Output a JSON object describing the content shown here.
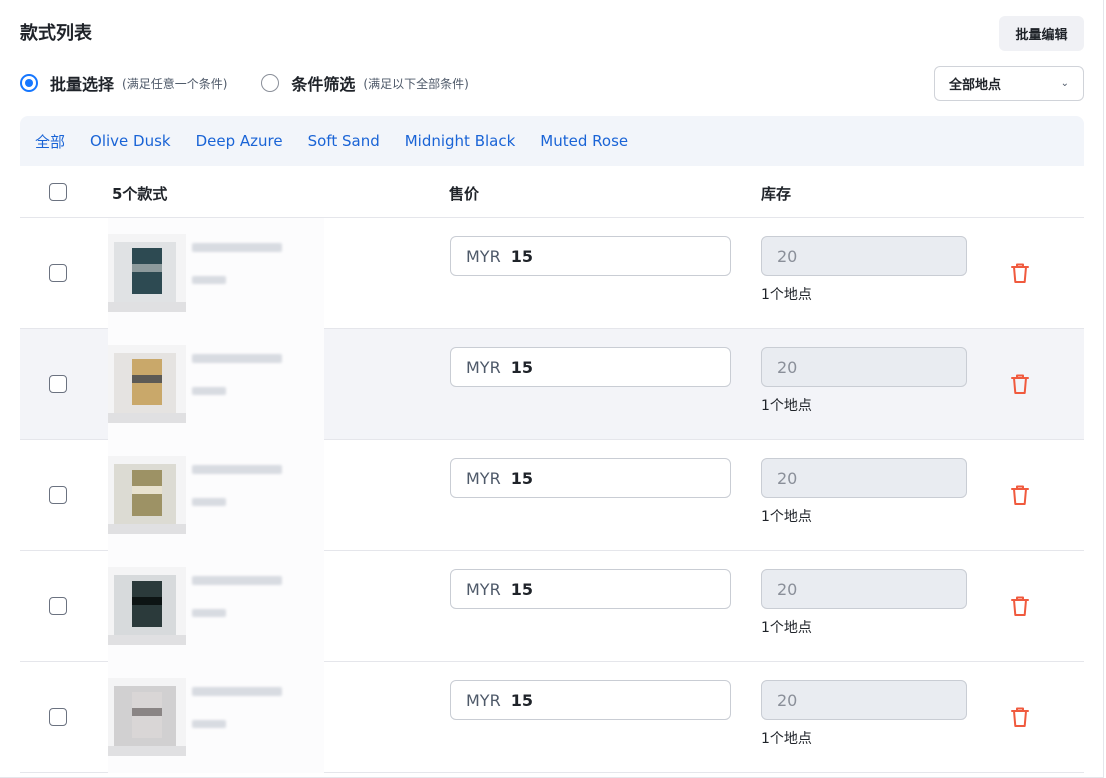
{
  "header": {
    "title": "款式列表",
    "bulk_edit_label": "批量编辑"
  },
  "mode": {
    "options": [
      {
        "label": "批量选择",
        "hint": "(满足任意一个条件)",
        "selected": true
      },
      {
        "label": "条件筛选",
        "hint": "(满足以下全部条件)",
        "selected": false
      }
    ]
  },
  "location_select": {
    "value": "全部地点"
  },
  "color_tabs": [
    "全部",
    "Olive Dusk",
    "Deep Azure",
    "Soft Sand",
    "Midnight Black",
    "Muted Rose"
  ],
  "table": {
    "headers": {
      "count": "5个款式",
      "price": "售价",
      "stock": "库存"
    },
    "rows": [
      {
        "currency": "MYR",
        "price": "15",
        "stock": "20",
        "locations": "1个地点",
        "highlighted": false,
        "thumb_colors": [
          "#cfd4d6",
          "#2d4a52",
          "#8d9a9c"
        ]
      },
      {
        "currency": "MYR",
        "price": "15",
        "stock": "20",
        "locations": "1个地点",
        "highlighted": true,
        "thumb_colors": [
          "#d9d6cf",
          "#c9a86a",
          "#5c5a55"
        ]
      },
      {
        "currency": "MYR",
        "price": "15",
        "stock": "20",
        "locations": "1个地点",
        "highlighted": false,
        "thumb_colors": [
          "#c9c6b6",
          "#9d9265",
          "#e8e2cf"
        ]
      },
      {
        "currency": "MYR",
        "price": "15",
        "stock": "20",
        "locations": "1个地点",
        "highlighted": false,
        "thumb_colors": [
          "#bfc4c6",
          "#2b3a3b",
          "#0d1414"
        ]
      },
      {
        "currency": "MYR",
        "price": "15",
        "stock": "20",
        "locations": "1个地点",
        "highlighted": false,
        "thumb_colors": [
          "#b5b3b3",
          "#d9d6d6",
          "#8a8585"
        ]
      }
    ]
  },
  "colors": {
    "accent": "#1677ff",
    "tab_link": "#1a64d6",
    "delete": "#f05a3e"
  }
}
